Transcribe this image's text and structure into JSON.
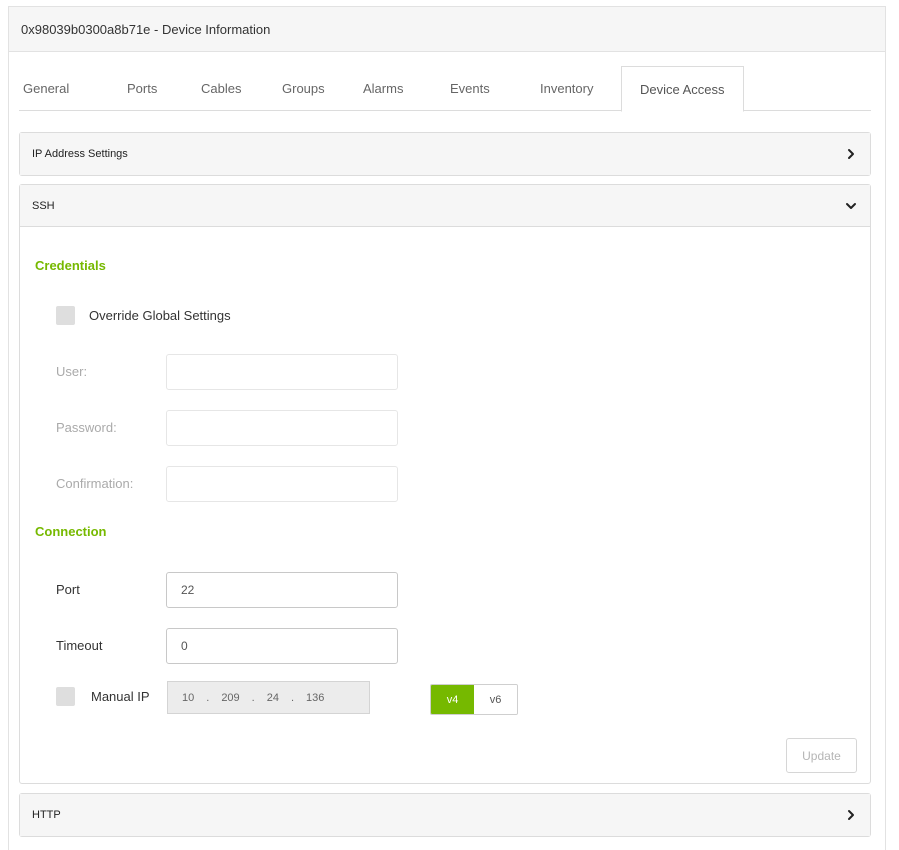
{
  "window": {
    "title": "0x98039b0300a8b71e - Device Information"
  },
  "tabs": [
    {
      "label": "General"
    },
    {
      "label": "Ports"
    },
    {
      "label": "Cables"
    },
    {
      "label": "Groups"
    },
    {
      "label": "Alarms"
    },
    {
      "label": "Events"
    },
    {
      "label": "Inventory"
    },
    {
      "label": "Device Access",
      "active": true
    }
  ],
  "panels": {
    "ip_address_settings": {
      "title": "IP Address Settings",
      "expanded": false
    },
    "ssh": {
      "title": "SSH",
      "expanded": true
    },
    "http": {
      "title": "HTTP",
      "expanded": false
    }
  },
  "ssh": {
    "credentials_heading": "Credentials",
    "override_label": "Override Global Settings",
    "override_checked": false,
    "user_label": "User:",
    "user_value": "",
    "password_label": "Password:",
    "password_value": "",
    "confirmation_label": "Confirmation:",
    "confirmation_value": "",
    "connection_heading": "Connection",
    "port_label": "Port",
    "port_value": "22",
    "timeout_label": "Timeout",
    "timeout_value": "0",
    "manual_ip_label": "Manual IP",
    "manual_ip_checked": false,
    "ip": {
      "o1": "10",
      "o2": "209",
      "o3": "24",
      "o4": "136",
      "sep": "."
    },
    "ip_version": {
      "v4": "v4",
      "v6": "v6",
      "selected": "v4"
    },
    "update_label": "Update"
  },
  "colors": {
    "accent": "#76b900",
    "header_bg": "#f6f6f6",
    "border": "#dcdcdc",
    "disabled_text": "#aaaaaa"
  },
  "icons": {
    "collapsed": "chevron-right-icon",
    "expanded": "chevron-down-icon"
  }
}
